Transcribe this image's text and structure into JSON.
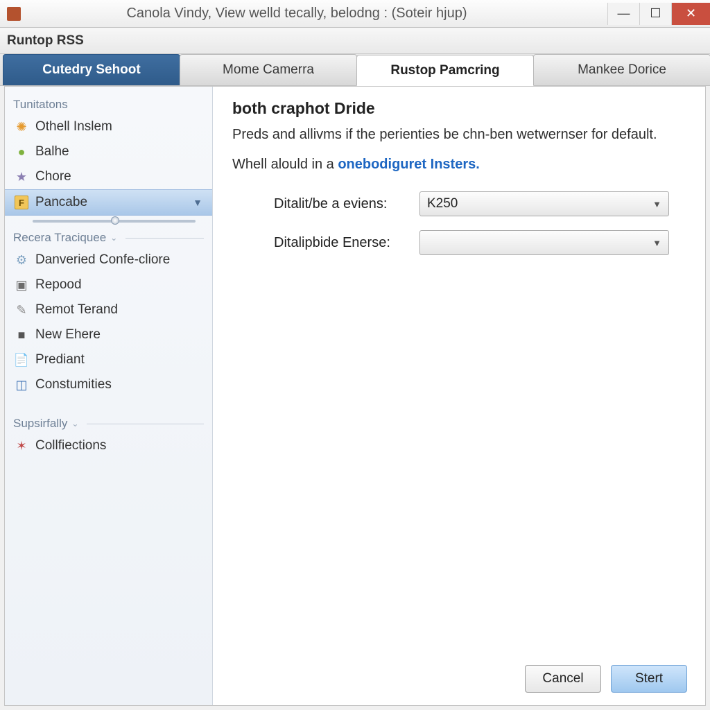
{
  "window": {
    "title": "Canola Vindy, View welld tecally, belodng : (Soteir hjup)"
  },
  "toolbar": {
    "label": "Runtop RSS"
  },
  "tabs": [
    {
      "label": "Cutedry Sehoot"
    },
    {
      "label": "Mome Camerra"
    },
    {
      "label": "Rustop Pamcring"
    },
    {
      "label": "Mankee Dorice"
    }
  ],
  "sidebar": {
    "section1": {
      "title": "Tunitatons",
      "items": [
        {
          "icon": "✺",
          "color": "#e59a2e",
          "label": "Othell Inslem"
        },
        {
          "icon": "●",
          "color": "#7fb23e",
          "label": "Balhe"
        },
        {
          "icon": "★",
          "color": "#8b7fb2",
          "label": "Chore"
        },
        {
          "icon": "F",
          "color": "#e0a82e",
          "label": "Pancabe"
        }
      ]
    },
    "section2": {
      "title": "Recera Traciquee",
      "items": [
        {
          "icon": "⚙",
          "color": "#7fa2c2",
          "label": "Danveried Confe-cliore"
        },
        {
          "icon": "▣",
          "color": "#6b6b6b",
          "label": "Repood"
        },
        {
          "icon": "✎",
          "color": "#8a8a8a",
          "label": "Remot Terand"
        },
        {
          "icon": "■",
          "color": "#555",
          "label": "New Ehere"
        },
        {
          "icon": "📄",
          "color": "#c56a4a",
          "label": "Prediant"
        },
        {
          "icon": "◫",
          "color": "#3a6fb3",
          "label": "Constumities"
        }
      ]
    },
    "section3": {
      "title": "Supsirfally",
      "items": [
        {
          "icon": "✶",
          "color": "#c04a4a",
          "label": "Collfiections"
        }
      ]
    }
  },
  "main": {
    "heading": "both craphot Dride",
    "desc": "Preds and allivms if the perienties be chn-ben wetwernser for default.",
    "line2_pre": "Whell alould in a ",
    "line2_link": "onebodiguret Insters.",
    "form": {
      "row1_label": "Ditalit/be a eviens:",
      "row1_value": "K250",
      "row2_label": "Ditalipbide Enerse:",
      "row2_value": ""
    }
  },
  "footer": {
    "cancel": "Cancel",
    "start": "Stert"
  }
}
